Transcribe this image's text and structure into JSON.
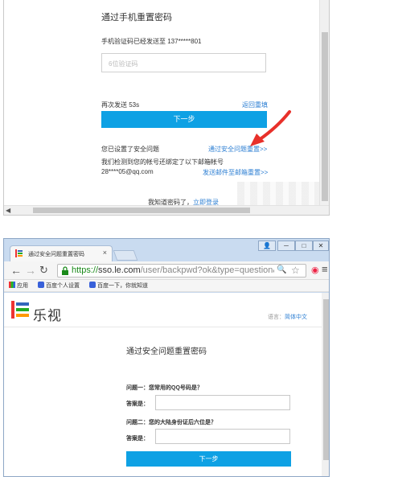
{
  "top": {
    "title": "通过手机重置密码",
    "sent_text": "手机验证码已经发送至 137*****801",
    "code_placeholder": "6位验证码",
    "resend": "再次发送 53s",
    "return_fill": "返回重填",
    "next_button": "下一步",
    "set_question": "您已设置了安全问题",
    "reset_via_question": "通过安全问题重置>>",
    "bound_email_text": "我们检测到您的帐号还绑定了以下邮箱帐号",
    "email": "28****05@qq.com",
    "reset_via_email": "发送邮件至邮箱重置>>",
    "know_password": "我知道密码了，",
    "login_now": "立即登录",
    "arrow_color": "#e8302a"
  },
  "browser": {
    "tab_title": "通过安全问题重置密码",
    "tab_close": "×",
    "url_https": "https://",
    "url_host": "sso.le.com",
    "url_rest": "/user/backpwd?ok&type=question&",
    "bookmarks": [
      {
        "label": "应用"
      },
      {
        "label": "百度个人设置"
      },
      {
        "label": "百度一下，你就知道"
      }
    ],
    "brand": "乐视",
    "lang_label": "语言：",
    "lang_value": "简体中文",
    "page_title": "通过安全问题重置密码",
    "question1": "问题一：您常用的QQ号码是？",
    "answer1_label": "答案是：",
    "question2": "问题二：您的大陆身份证后六位是？",
    "answer2_label": "答案是：",
    "next_button": "下一步"
  },
  "colors": {
    "primary_button": "#0ea1e4",
    "link": "#2d7fd3",
    "https_green": "#1a8a1a"
  }
}
